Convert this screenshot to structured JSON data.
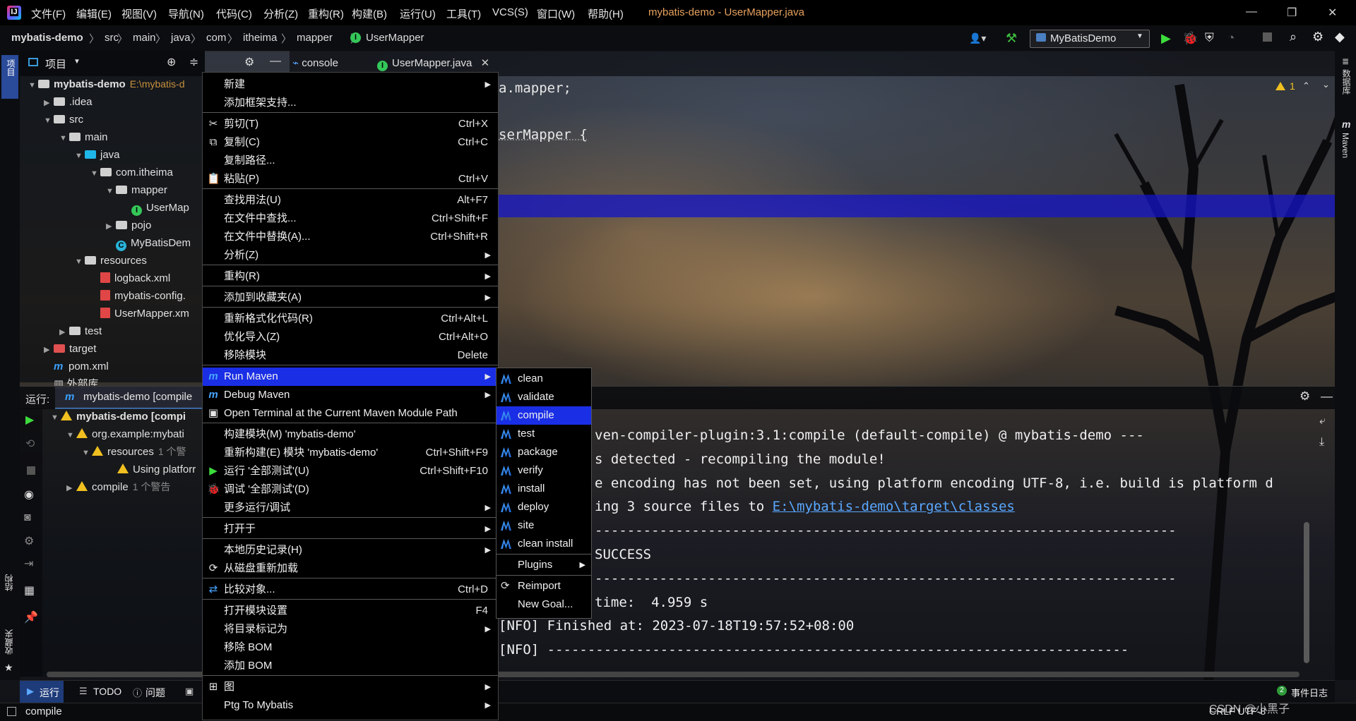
{
  "title_bar": {
    "menu": [
      "文件(F)",
      "编辑(E)",
      "视图(V)",
      "导航(N)",
      "代码(C)",
      "分析(Z)",
      "重构(R)",
      "构建(B)",
      "运行(U)",
      "工具(T)",
      "VCS(S)",
      "窗口(W)",
      "帮助(H)"
    ],
    "window_title": "mybatis-demo - UserMapper.java"
  },
  "nav_bar": {
    "breadcrumbs": [
      "mybatis-demo",
      "src",
      "main",
      "java",
      "com",
      "itheima",
      "mapper",
      "UserMapper"
    ],
    "run_config": "MyBatisDemo"
  },
  "left_strip": {
    "project_label": "项目",
    "structure_label": "结构",
    "favorites_label": "收藏夹"
  },
  "right_strip": {
    "database_label": "数据库",
    "maven_label": "Maven"
  },
  "project_panel": {
    "title": "项目",
    "tree": [
      {
        "label": "mybatis-demo",
        "suffix": "E:\\mybatis-d",
        "icon": "folder-icon"
      },
      {
        "label": ".idea",
        "icon": "folder-icon"
      },
      {
        "label": "src",
        "icon": "folder-icon"
      },
      {
        "label": "main",
        "icon": "folder-icon"
      },
      {
        "label": "java",
        "icon": "folder-blue-icon"
      },
      {
        "label": "com.itheima",
        "icon": "package-icon"
      },
      {
        "label": "mapper",
        "icon": "package-icon"
      },
      {
        "label": "UserMap",
        "icon": "interface-icon"
      },
      {
        "label": "pojo",
        "icon": "package-icon"
      },
      {
        "label": "MyBatisDem",
        "icon": "class-icon"
      },
      {
        "label": "resources",
        "icon": "folder-icon"
      },
      {
        "label": "logback.xml",
        "icon": "xml-icon"
      },
      {
        "label": "mybatis-config.",
        "icon": "xml-icon"
      },
      {
        "label": "UserMapper.xm",
        "icon": "xml-icon"
      },
      {
        "label": "test",
        "icon": "folder-icon"
      },
      {
        "label": "target",
        "icon": "folder-red-icon"
      },
      {
        "label": "pom.xml",
        "icon": "maven-icon"
      },
      {
        "label": "外部库",
        "icon": "library-icon"
      }
    ]
  },
  "editor": {
    "tabs": [
      {
        "label": "console",
        "icon": "console-icon"
      },
      {
        "label": "UserMapper.java",
        "icon": "interface-icon"
      }
    ],
    "code_lines": [
      "a.mapper;",
      "serMapper {"
    ],
    "warning_count": "1"
  },
  "run_panel": {
    "label": "运行:",
    "tab": "mybatis-demo [compile",
    "tree": [
      {
        "label": "mybatis-demo [compi",
        "level": 0
      },
      {
        "label": "org.example:mybati",
        "level": 1
      },
      {
        "label": "resources",
        "suffix": "1 个警",
        "level": 2
      },
      {
        "label": "Using platforr",
        "level": 3
      },
      {
        "label": "compile",
        "suffix": "1 个警告",
        "level": 1
      }
    ],
    "console": [
      "ven-compiler-plugin:3.1:compile (default-compile) @ mybatis-demo ---",
      "s detected - recompiling the module!",
      "e encoding has not been set, using platform encoding UTF-8, i.e. build is platform d",
      "ing 3 source files to ",
      "------------------------------------------------------------------------",
      "SUCCESS",
      "------------------------------------------------------------------------",
      "time:  4.959 s",
      "[NFO] Finished at: 2023-07-18T19:57:52+08:00",
      "[NFO] ------------------------------------------------------------------------"
    ],
    "console_link": "E:\\mybatis-demo\\target\\classes"
  },
  "context_menu": {
    "items": [
      {
        "label": "新建",
        "shortcut": "",
        "submenu": true
      },
      {
        "label": "添加框架支持...",
        "shortcut": ""
      },
      {
        "label": "剪切(T)",
        "shortcut": "Ctrl+X",
        "icon": "scissors-icon"
      },
      {
        "label": "复制(C)",
        "shortcut": "Ctrl+C",
        "icon": "copy-icon"
      },
      {
        "label": "复制路径...",
        "shortcut": ""
      },
      {
        "label": "粘贴(P)",
        "shortcut": "Ctrl+V",
        "icon": "paste-icon"
      },
      {
        "label": "查找用法(U)",
        "shortcut": "Alt+F7"
      },
      {
        "label": "在文件中查找...",
        "shortcut": "Ctrl+Shift+F"
      },
      {
        "label": "在文件中替换(A)...",
        "shortcut": "Ctrl+Shift+R"
      },
      {
        "label": "分析(Z)",
        "shortcut": "",
        "submenu": true
      },
      {
        "label": "重构(R)",
        "shortcut": "",
        "submenu": true
      },
      {
        "label": "添加到收藏夹(A)",
        "shortcut": "",
        "submenu": true
      },
      {
        "label": "重新格式化代码(R)",
        "shortcut": "Ctrl+Alt+L"
      },
      {
        "label": "优化导入(Z)",
        "shortcut": "Ctrl+Alt+O"
      },
      {
        "label": "移除模块",
        "shortcut": "Delete"
      },
      {
        "label": "Run Maven",
        "shortcut": "",
        "submenu": true,
        "icon": "maven-run-icon",
        "active": true
      },
      {
        "label": "Debug Maven",
        "shortcut": "",
        "submenu": true,
        "icon": "maven-debug-icon"
      },
      {
        "label": "Open Terminal at the Current Maven Module Path",
        "shortcut": "",
        "icon": "terminal-icon"
      },
      {
        "label": "构建模块(M) 'mybatis-demo'",
        "shortcut": ""
      },
      {
        "label": "重新构建(E) 模块 'mybatis-demo'",
        "shortcut": "Ctrl+Shift+F9"
      },
      {
        "label": "运行 '全部测试'(U)",
        "shortcut": "Ctrl+Shift+F10",
        "icon": "run-icon"
      },
      {
        "label": "调试 '全部测试'(D)",
        "shortcut": "",
        "icon": "debug-icon"
      },
      {
        "label": "更多运行/调试",
        "shortcut": "",
        "submenu": true
      },
      {
        "label": "打开于",
        "shortcut": "",
        "submenu": true
      },
      {
        "label": "本地历史记录(H)",
        "shortcut": "",
        "submenu": true
      },
      {
        "label": "从磁盘重新加载",
        "shortcut": "",
        "icon": "reload-icon"
      },
      {
        "label": "比较对象...",
        "shortcut": "Ctrl+D",
        "icon": "compare-icon"
      },
      {
        "label": "打开模块设置",
        "shortcut": "F4"
      },
      {
        "label": "将目录标记为",
        "shortcut": "",
        "submenu": true
      },
      {
        "label": "移除 BOM",
        "shortcut": ""
      },
      {
        "label": "添加 BOM",
        "shortcut": ""
      },
      {
        "label": "图",
        "shortcut": "",
        "submenu": true,
        "icon": "diagram-icon"
      },
      {
        "label": "Ptg To Mybatis",
        "shortcut": "",
        "submenu": true
      }
    ]
  },
  "maven_submenu": {
    "items": [
      {
        "label": "clean",
        "icon": "maven-goal-icon"
      },
      {
        "label": "validate",
        "icon": "maven-goal-icon"
      },
      {
        "label": "compile",
        "icon": "maven-goal-icon",
        "active": true
      },
      {
        "label": "test",
        "icon": "maven-goal-icon"
      },
      {
        "label": "package",
        "icon": "maven-goal-icon"
      },
      {
        "label": "verify",
        "icon": "maven-goal-icon"
      },
      {
        "label": "install",
        "icon": "maven-goal-icon"
      },
      {
        "label": "deploy",
        "icon": "maven-goal-icon"
      },
      {
        "label": "site",
        "icon": "maven-goal-icon"
      },
      {
        "label": "clean install",
        "icon": "maven-goal-icon"
      },
      {
        "label": "Plugins",
        "submenu": true
      },
      {
        "label": "Reimport",
        "icon": "reload-icon"
      },
      {
        "label": "New Goal..."
      }
    ]
  },
  "tool_windows": [
    {
      "label": "运行",
      "icon": "run-icon"
    },
    {
      "label": "TODO",
      "icon": "todo-icon"
    },
    {
      "label": "问题",
      "icon": "problems-icon"
    }
  ],
  "status_bar": {
    "message": "compile",
    "event_log": "事件日志",
    "event_count": "2",
    "encoding": "CRLF UTF-8",
    "watermark": "CSDN @小黑子"
  }
}
